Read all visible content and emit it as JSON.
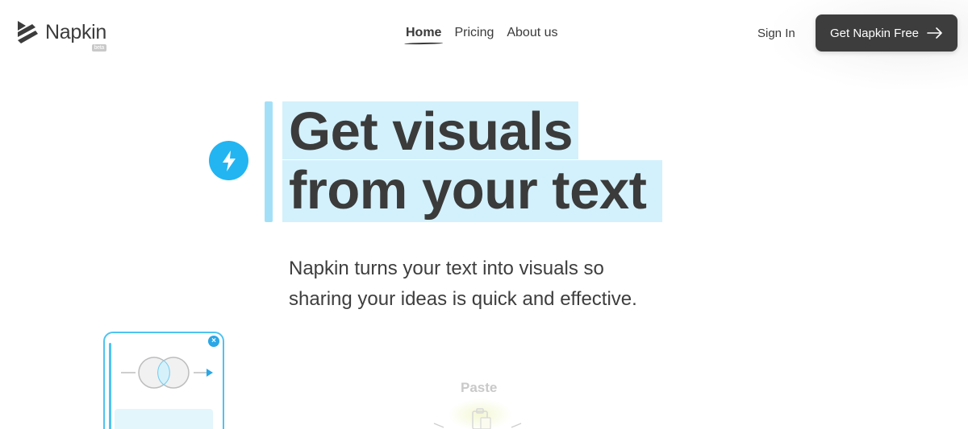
{
  "header": {
    "logo_text": "Napkin",
    "logo_badge": "beta",
    "nav": [
      {
        "label": "Home",
        "active": true
      },
      {
        "label": "Pricing",
        "active": false
      },
      {
        "label": "About us",
        "active": false
      }
    ],
    "sign_in": "Sign In",
    "cta_label": "Get Napkin Free",
    "cta_icon": "arrow-right-icon"
  },
  "hero": {
    "badge_icon": "lightning-bolt-icon",
    "headline_line1": "Get visuals",
    "headline_line2": "from your text",
    "subtitle": "Napkin turns your text into visuals so sharing your ideas is quick and effective."
  },
  "illustration": {
    "paste_label": "Paste",
    "close_icon": "close-icon"
  },
  "colors": {
    "accent": "#22b5f2",
    "highlight": "#d3f1fc",
    "cta_bg": "#3d3d3d",
    "text": "#3b3b3b"
  }
}
